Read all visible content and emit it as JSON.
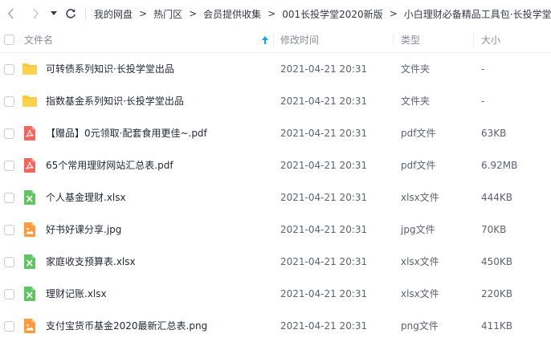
{
  "nav": {
    "back_icon": "chevron-left-icon",
    "forward_icon": "chevron-right-icon",
    "dropdown_icon": "caret-down-icon",
    "refresh_icon": "refresh-icon",
    "breadcrumb": [
      "我的网盘",
      "热门区",
      "会员提供收集",
      "001长投学堂2020新版",
      "小白理财必备精品工具包·长投学堂出"
    ],
    "separator": ">"
  },
  "table": {
    "headers": {
      "name": "文件名",
      "modified": "修改时间",
      "type": "类型",
      "size": "大小"
    },
    "sort_icon": "sort-up-arrow-icon",
    "sort_color": "#06a7ff",
    "rows": [
      {
        "name": "可转债系列知识·长投学堂出品",
        "modified": "2021-04-21 20:31",
        "type": "文件夹",
        "size": "-",
        "icon": "folder-icon"
      },
      {
        "name": "指数基金系列知识·长投学堂出品",
        "modified": "2021-04-21 20:31",
        "type": "文件夹",
        "size": "-",
        "icon": "folder-icon"
      },
      {
        "name": "【赠品】0元领取·配套食用更佳~.pdf",
        "modified": "2021-04-21 20:31",
        "type": "pdf文件",
        "size": "63KB",
        "icon": "pdf-icon"
      },
      {
        "name": "65个常用理财网站汇总表.pdf",
        "modified": "2021-04-21 20:31",
        "type": "pdf文件",
        "size": "6.92MB",
        "icon": "pdf-icon"
      },
      {
        "name": "个人基金理财.xlsx",
        "modified": "2021-04-21 20:31",
        "type": "xlsx文件",
        "size": "444KB",
        "icon": "excel-icon"
      },
      {
        "name": "好书好课分享.jpg",
        "modified": "2021-04-21 20:31",
        "type": "jpg文件",
        "size": "70KB",
        "icon": "image-icon"
      },
      {
        "name": "家庭收支预算表.xlsx",
        "modified": "2021-04-21 20:31",
        "type": "xlsx文件",
        "size": "450KB",
        "icon": "excel-icon"
      },
      {
        "name": "理财记账.xlsx",
        "modified": "2021-04-21 20:31",
        "type": "xlsx文件",
        "size": "220KB",
        "icon": "excel-icon"
      },
      {
        "name": "支付宝货币基金2020最新汇总表.png",
        "modified": "2021-04-21 20:31",
        "type": "png文件",
        "size": "411KB",
        "icon": "image-icon"
      }
    ]
  },
  "colors": {
    "folder": "#ffc83d",
    "pdf": "#f46560",
    "excel": "#5ec562",
    "image": "#ff9a3c"
  }
}
